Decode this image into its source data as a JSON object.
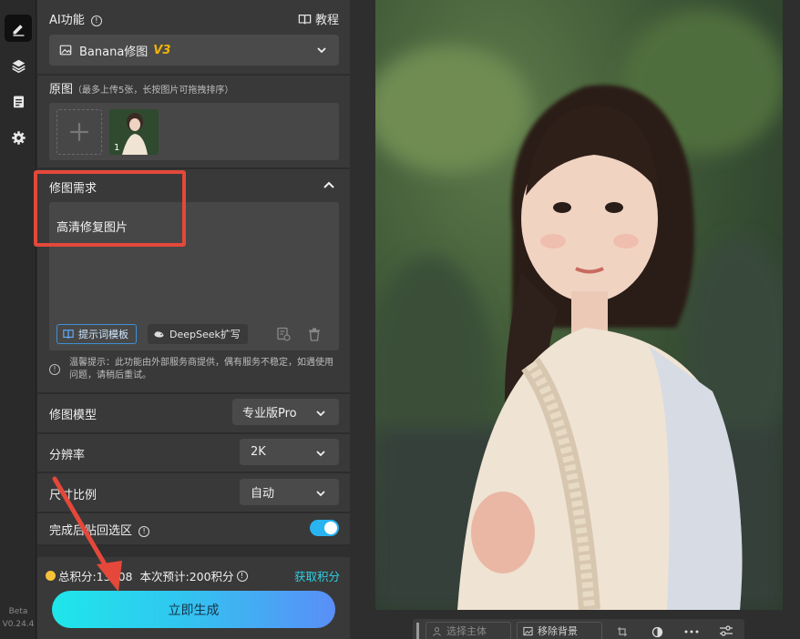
{
  "rail": {
    "items": [
      "edit-tool",
      "layers-tool",
      "notes-tool",
      "settings-tool"
    ],
    "version_line1": "Beta",
    "version_line2": "V0.24.4"
  },
  "header": {
    "title": "AI功能",
    "tutorial_label": "教程"
  },
  "mode_select": {
    "value": "Banana修图",
    "badge": "V3"
  },
  "original": {
    "label": "原图",
    "hint": "（最多上传5张，长按图片可拖拽排序）",
    "thumb_index": "1"
  },
  "requirement": {
    "label": "修图需求",
    "text": "高清修复图片",
    "template_button": "提示词模板",
    "deepseek_button": "DeepSeek扩写",
    "notice": "温馨提示：此功能由外部服务商提供，偶有服务不稳定，如遇使用问题，请稍后重试。"
  },
  "settings": {
    "model_label": "修图模型",
    "model_value": "专业版Pro",
    "resolution_label": "分辨率",
    "resolution_value": "2K",
    "ratio_label": "尺寸比例",
    "ratio_value": "自动",
    "paste_label": "完成后贴回选区",
    "paste_enabled": true
  },
  "footer": {
    "points_text": "总积分:13508",
    "estimate_text": "本次预计:200积分",
    "get_points": "获取积分",
    "generate_label": "立即生成"
  },
  "toolbar": {
    "select_subject": "选择主体",
    "remove_bg": "移除背景"
  },
  "colors": {
    "accent": "#29b3f0",
    "badge": "#f0b400",
    "link": "#2fd0e6",
    "annotation": "#e4483a"
  }
}
